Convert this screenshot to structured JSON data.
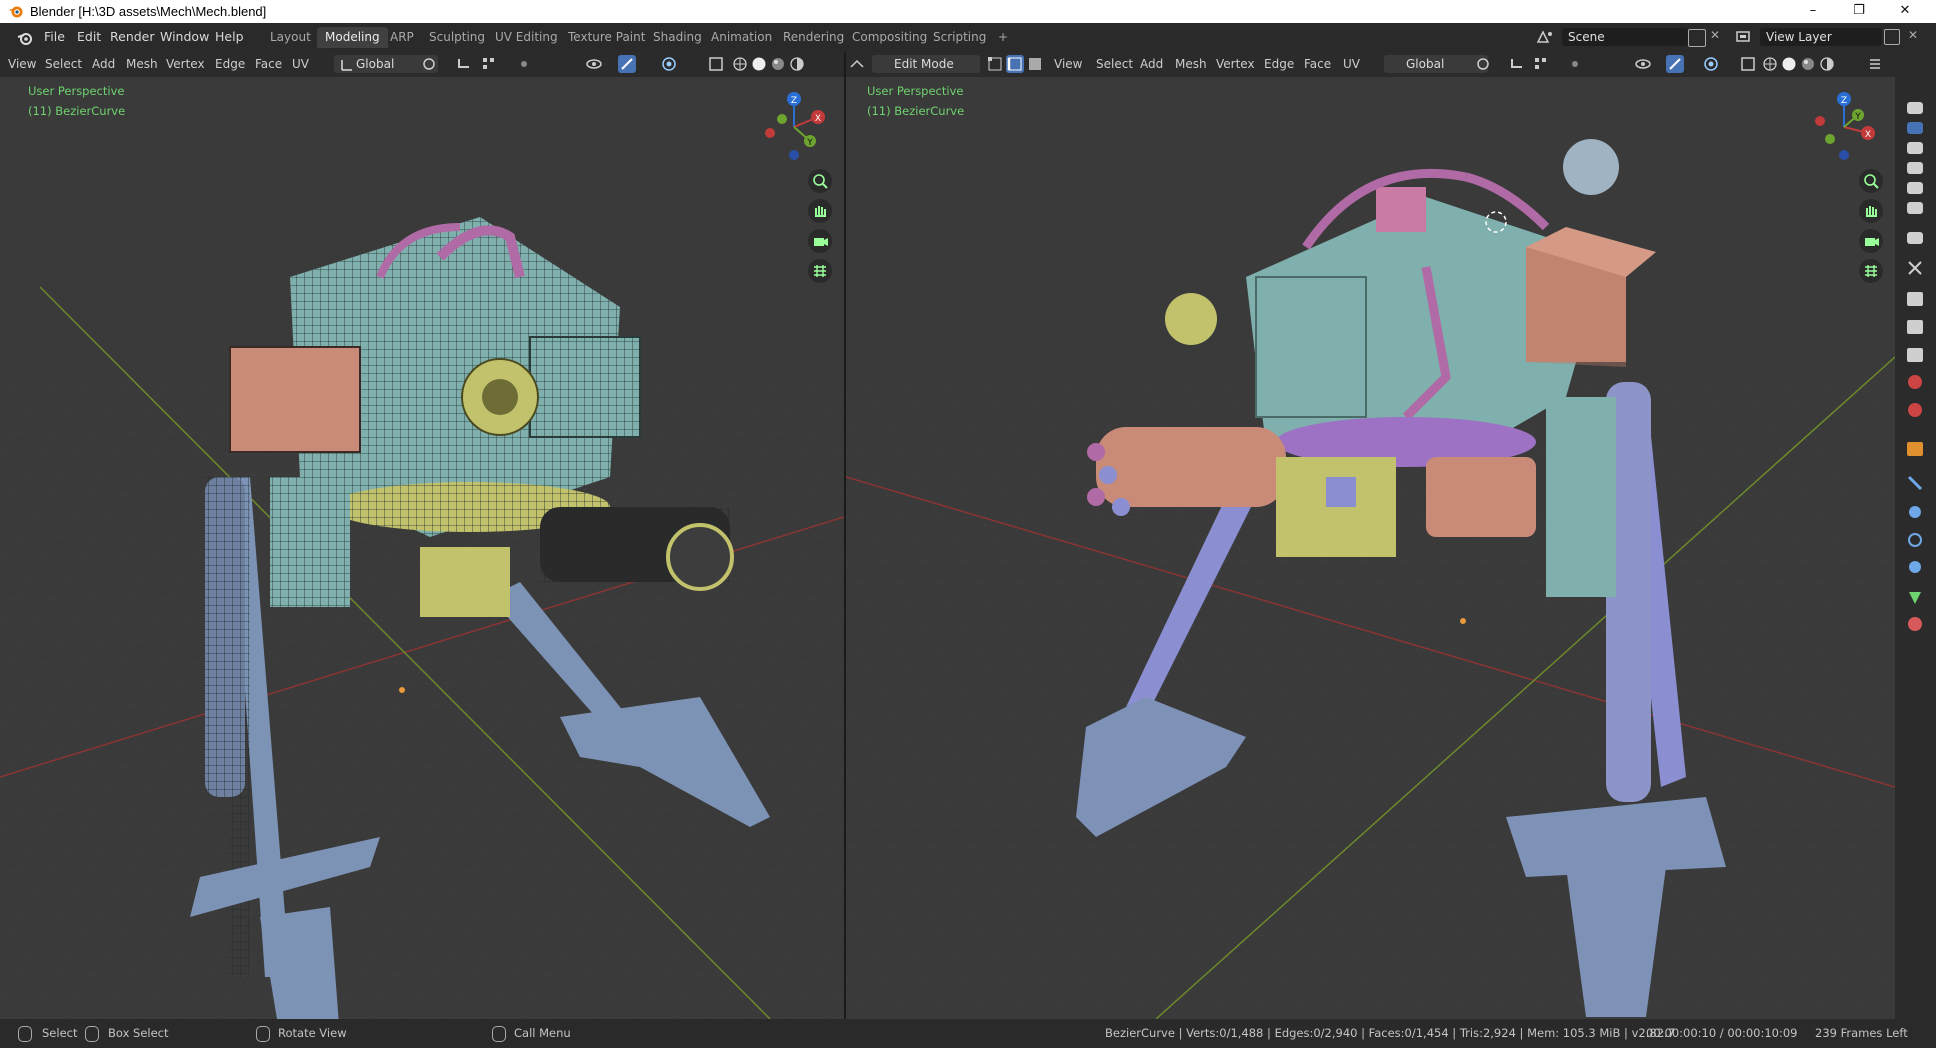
{
  "window": {
    "title": "Blender [H:\\3D assets\\Mech\\Mech.blend]",
    "minimize": "–",
    "restore": "❐",
    "close": "✕"
  },
  "menu": [
    "File",
    "Edit",
    "Render",
    "Window",
    "Help"
  ],
  "workspaces": {
    "tabs": [
      "Layout",
      "Modeling",
      "ARP",
      "Sculpting",
      "UV Editing",
      "Texture Paint",
      "Shading",
      "Animation",
      "Rendering",
      "Compositing",
      "Scripting"
    ],
    "active": "Modeling",
    "add": "+"
  },
  "scene": {
    "label": "Scene",
    "view_layer": "View Layer"
  },
  "left_viewport": {
    "menus": [
      "View",
      "Select",
      "Add",
      "Mesh",
      "Vertex",
      "Edge",
      "Face",
      "UV"
    ],
    "transform": "Global",
    "perspective": "User Perspective",
    "object": "(11) BezierCurve"
  },
  "right_viewport": {
    "mode": "Edit Mode",
    "menus": [
      "View",
      "Select",
      "Add",
      "Mesh",
      "Vertex",
      "Edge",
      "Face",
      "UV"
    ],
    "transform": "Global",
    "perspective": "User Perspective",
    "object": "(11) BezierCurve"
  },
  "gizmo": {
    "z": "Z",
    "y": "Y",
    "x": "X"
  },
  "statusbar": {
    "select": "Select",
    "box_select": "Box Select",
    "rotate": "Rotate View",
    "call_menu": "Call Menu",
    "stats": "BezierCurve | Verts:0/1,488 | Edges:0/2,940 | Faces:0/1,454 | Tris:2,924 | Mem: 105.3 MiB | v2.82.7",
    "time": "00:00:00:10 / 00:00:10:09",
    "frames_left": "239 Frames Left"
  },
  "colors": {
    "grid_x": "#8a3434",
    "grid_y": "#6c8a2a",
    "accent": "#4772b3",
    "label_green": "#6fd36f",
    "mech_teal": "#7fb0ad",
    "mech_salmon": "#c98b77",
    "mech_pink": "#b06aa5",
    "mech_lavender": "#8b8fd1",
    "mech_yellow": "#c2c26c",
    "mech_purple": "#9d72c5"
  },
  "icons": [
    "blender-logo-icon",
    "transform-orientation-icon",
    "snap-icon",
    "overlay-icon",
    "shading-solid-icon",
    "zoom-icon",
    "hand-icon",
    "camera-icon",
    "grid-icon",
    "wrench-icon",
    "scene-icon"
  ]
}
